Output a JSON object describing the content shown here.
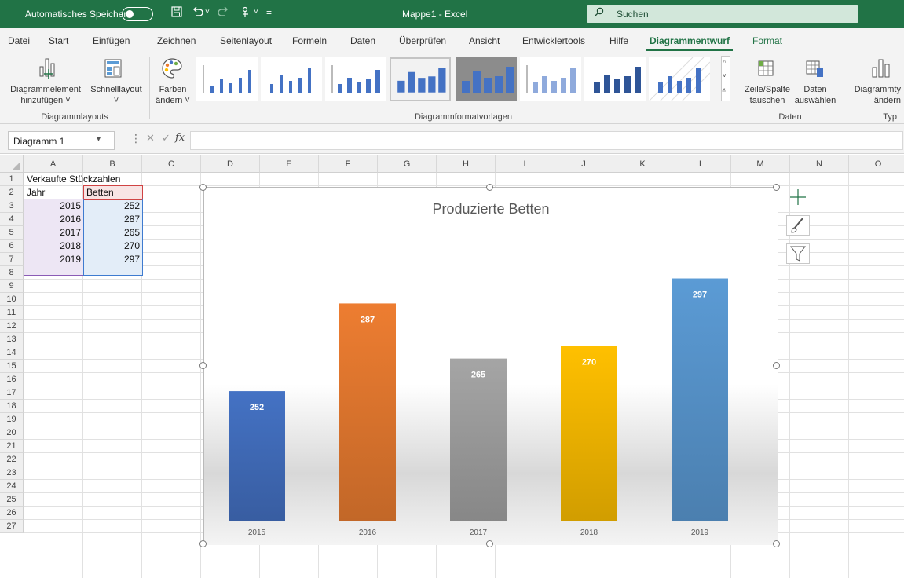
{
  "titlebar": {
    "autosave_label": "Automatisches Speichern",
    "doc_title": "Mappe1  -  Excel",
    "search_label": "Suchen",
    "colors": {
      "accent": "#217346"
    }
  },
  "tabs": [
    {
      "label": "Datei"
    },
    {
      "label": "Start"
    },
    {
      "label": "Einfügen"
    },
    {
      "label": "Zeichnen"
    },
    {
      "label": "Seitenlayout"
    },
    {
      "label": "Formeln"
    },
    {
      "label": "Daten"
    },
    {
      "label": "Überprüfen"
    },
    {
      "label": "Ansicht"
    },
    {
      "label": "Entwicklertools"
    },
    {
      "label": "Hilfe"
    },
    {
      "label": "Diagrammentwurf"
    },
    {
      "label": "Format"
    }
  ],
  "ribbon": {
    "add_element": {
      "line1": "Diagrammelement",
      "line2": "hinzufügen ˅"
    },
    "quick_layout": {
      "line1": "Schnelllayout",
      "line2": "˅"
    },
    "colors": {
      "line1": "Farben",
      "line2": "ändern ˅"
    },
    "switch_rowcol": {
      "line1": "Zeile/Spalte",
      "line2": "tauschen"
    },
    "select_data": {
      "line1": "Daten",
      "line2": "auswählen"
    },
    "change_type": {
      "line1": "Diagrammty",
      "line2": "ändern"
    },
    "groups": {
      "layouts": "Diagrammlayouts",
      "styles": "Diagrammformatvorlagen",
      "data": "Daten",
      "type": "Typ"
    }
  },
  "formulabar": {
    "namebox": "Diagramm 1",
    "fx": "fx",
    "value": ""
  },
  "sheet": {
    "columns": [
      "A",
      "B",
      "C",
      "D",
      "E",
      "F",
      "G",
      "H",
      "I",
      "J",
      "K",
      "L",
      "M",
      "N",
      "O"
    ],
    "rows": [
      "1",
      "2",
      "3",
      "4",
      "5",
      "6",
      "7",
      "8",
      "9",
      "10",
      "11",
      "12",
      "13",
      "14",
      "15",
      "16",
      "17",
      "18",
      "19",
      "20",
      "21",
      "22",
      "23",
      "24",
      "25",
      "26",
      "27"
    ],
    "a1": "Verkaufte Stückzahlen",
    "header_year": "Jahr",
    "header_beds": "Betten",
    "table": [
      {
        "year": "2015",
        "beds": "252"
      },
      {
        "year": "2016",
        "beds": "287"
      },
      {
        "year": "2017",
        "beds": "265"
      },
      {
        "year": "2018",
        "beds": "270"
      },
      {
        "year": "2019",
        "beds": "297"
      }
    ]
  },
  "chart_data": {
    "type": "bar",
    "title": "Produzierte Betten",
    "categories": [
      "2015",
      "2016",
      "2017",
      "2018",
      "2019"
    ],
    "values": [
      252,
      287,
      265,
      270,
      297
    ],
    "data_labels": [
      "252",
      "287",
      "265",
      "270",
      "297"
    ],
    "colors": [
      "#4472c4",
      "#ed7d31",
      "#a5a5a5",
      "#ffc000",
      "#5b9bd5"
    ],
    "ylim": [
      200,
      305
    ],
    "grid": false,
    "legend": "none"
  }
}
